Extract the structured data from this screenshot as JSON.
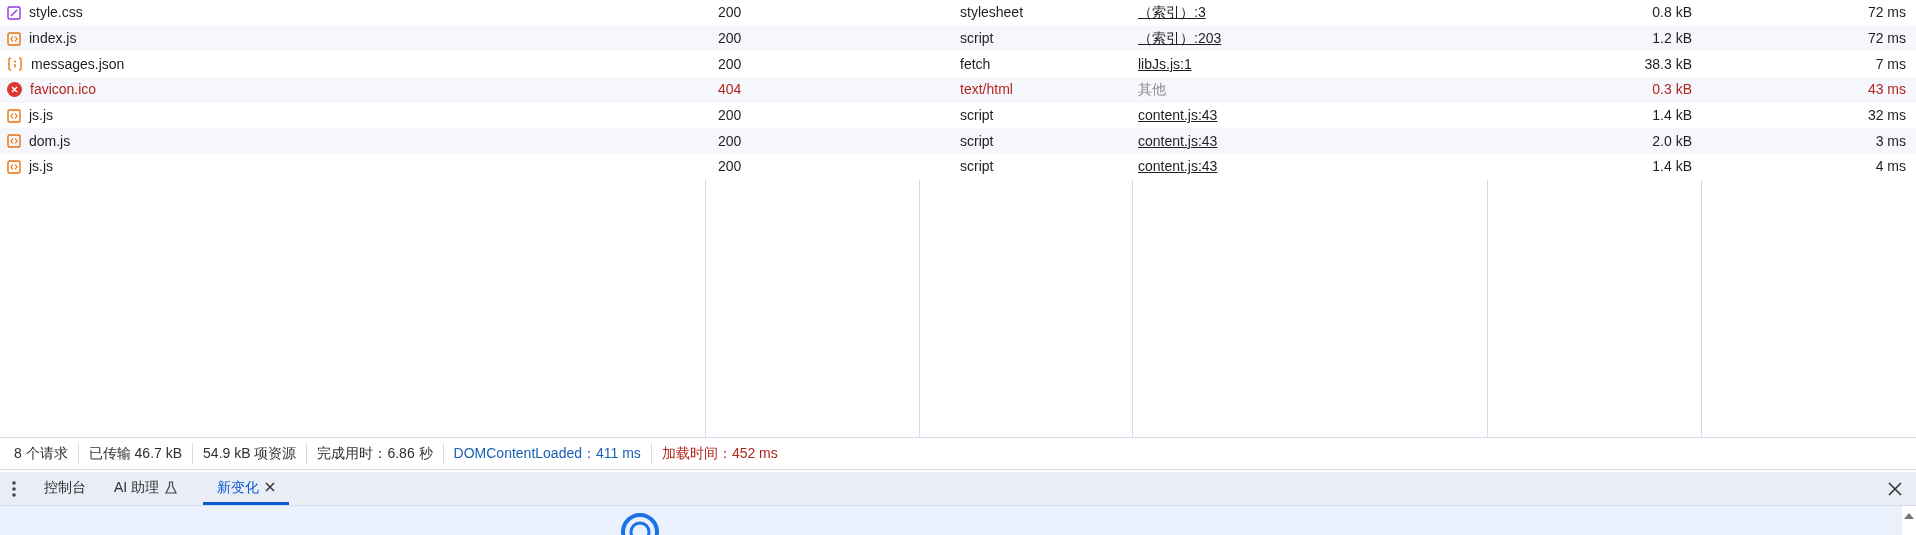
{
  "table": {
    "rows": [
      {
        "kind": "stylesheet",
        "name": "style.css",
        "status": "200",
        "type": "stylesheet",
        "initiator": "（索引）:3",
        "initiator_link": true,
        "size": "0.8 kB",
        "time": "72 ms",
        "failed": false
      },
      {
        "kind": "script",
        "name": "index.js",
        "status": "200",
        "type": "script",
        "initiator": "（索引）:203",
        "initiator_link": true,
        "size": "1.2 kB",
        "time": "72 ms",
        "failed": false
      },
      {
        "kind": "json",
        "name": "messages.json",
        "status": "200",
        "type": "fetch",
        "initiator": "libJs.js:1",
        "initiator_link": true,
        "size": "38.3 kB",
        "time": "7 ms",
        "failed": false
      },
      {
        "kind": "error",
        "name": "favicon.ico",
        "status": "404",
        "type": "text/html",
        "initiator": "其他",
        "initiator_link": false,
        "size": "0.3 kB",
        "time": "43 ms",
        "failed": true
      },
      {
        "kind": "script",
        "name": "js.js",
        "status": "200",
        "type": "script",
        "initiator": "content.js:43",
        "initiator_link": true,
        "size": "1.4 kB",
        "time": "32 ms",
        "failed": false
      },
      {
        "kind": "script",
        "name": "dom.js",
        "status": "200",
        "type": "script",
        "initiator": "content.js:43",
        "initiator_link": true,
        "size": "2.0 kB",
        "time": "3 ms",
        "failed": false
      },
      {
        "kind": "script",
        "name": "js.js",
        "status": "200",
        "type": "script",
        "initiator": "content.js:43",
        "initiator_link": true,
        "size": "1.4 kB",
        "time": "4 ms",
        "failed": false
      }
    ]
  },
  "status_bar": [
    {
      "kind": "plain",
      "text": "8 个请求"
    },
    {
      "kind": "plain",
      "text": "已传输 46.7 kB"
    },
    {
      "kind": "plain",
      "text": "54.9 kB 项资源"
    },
    {
      "kind": "plain",
      "text": "完成用时：6.86 秒"
    },
    {
      "kind": "dom",
      "text": "DOMContentLoaded：411 ms"
    },
    {
      "kind": "load",
      "text": "加载时间：452 ms"
    }
  ],
  "drawer": {
    "tabs": [
      {
        "label": "控制台",
        "selected": false,
        "experimental": false,
        "closable": false
      },
      {
        "label": "AI 助理",
        "selected": false,
        "experimental": true,
        "closable": false
      },
      {
        "label": "新变化",
        "selected": true,
        "experimental": false,
        "closable": true
      }
    ]
  }
}
